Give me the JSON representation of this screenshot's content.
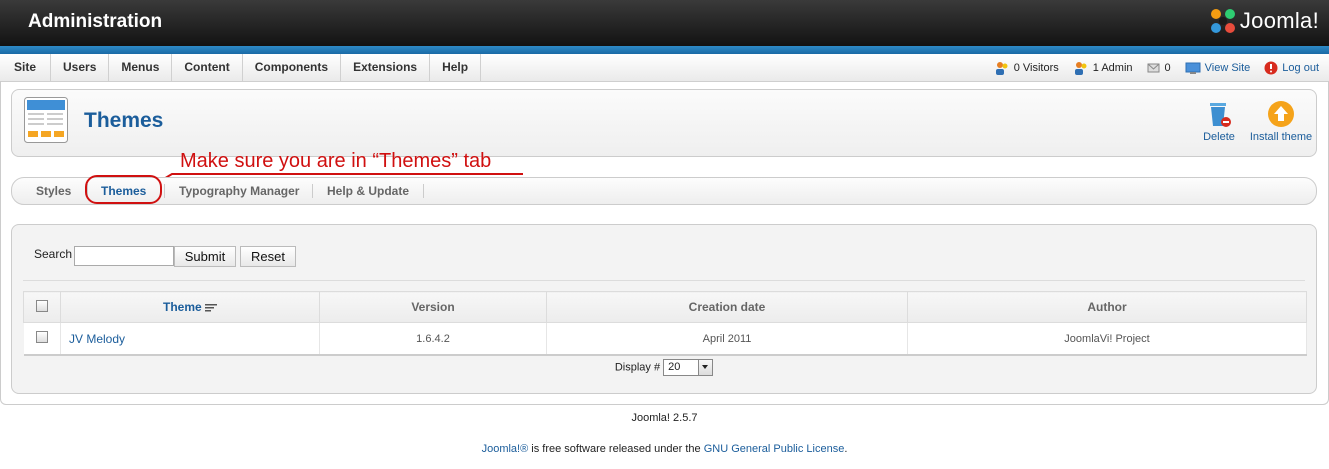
{
  "header": {
    "title": "Administration",
    "logo_text": "Joomla!"
  },
  "menu": [
    "Site",
    "Users",
    "Menus",
    "Content",
    "Components",
    "Extensions",
    "Help"
  ],
  "status": {
    "visitors": "0 Visitors",
    "admin": "1 Admin",
    "messages": "0",
    "view_site": "View Site",
    "logout": "Log out"
  },
  "toolbar": {
    "title": "Themes",
    "delete_label": "Delete",
    "install_label": "Install theme"
  },
  "annotation": "Make sure you are in “Themes” tab",
  "subtabs": [
    "Styles",
    "Themes",
    "Typography Manager",
    "Help & Update"
  ],
  "filter": {
    "search_label": "Search",
    "search_value": "",
    "submit_label": "Submit",
    "reset_label": "Reset"
  },
  "table": {
    "headers": [
      "Theme",
      "Version",
      "Creation date",
      "Author"
    ],
    "rows": [
      {
        "theme": "JV Melody",
        "version": "1.6.4.2",
        "date": "April 2011",
        "author": "JoomlaVi! Project"
      }
    ]
  },
  "pagination": {
    "label": "Display #",
    "value": "20"
  },
  "footer": {
    "version": "Joomla! 2.5.7",
    "joomla_link": "Joomla!®",
    "middle": " is free software released under the ",
    "license_link": "GNU General Public License",
    "end": "."
  },
  "colors": {
    "accent": "#1b5d9b",
    "annotation": "#d01010",
    "header_bg": "#1e1e1e",
    "bar_blue": "#2d8ac7"
  }
}
